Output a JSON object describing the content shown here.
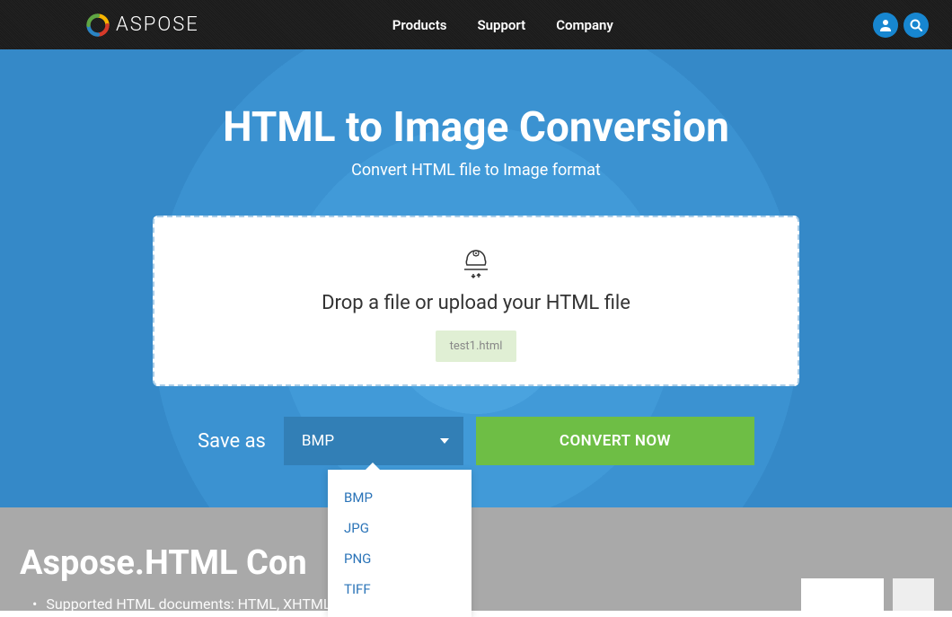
{
  "header": {
    "brand": "ASPOSE",
    "nav": [
      "Products",
      "Support",
      "Company"
    ]
  },
  "hero": {
    "title": "HTML to Image Conversion",
    "subtitle": "Convert HTML file to Image format",
    "drop_label": "Drop a file or upload your HTML file",
    "file_name": "test1.html"
  },
  "controls": {
    "saveas_label": "Save as",
    "selected_format": "BMP",
    "convert_label": "CONVERT NOW",
    "format_options": [
      "BMP",
      "JPG",
      "PNG",
      "TIFF"
    ]
  },
  "lower": {
    "title": "Aspose.HTML Con",
    "bullet": "Supported HTML documents: HTML, XHTML, MHTML, EPUB, SV"
  }
}
